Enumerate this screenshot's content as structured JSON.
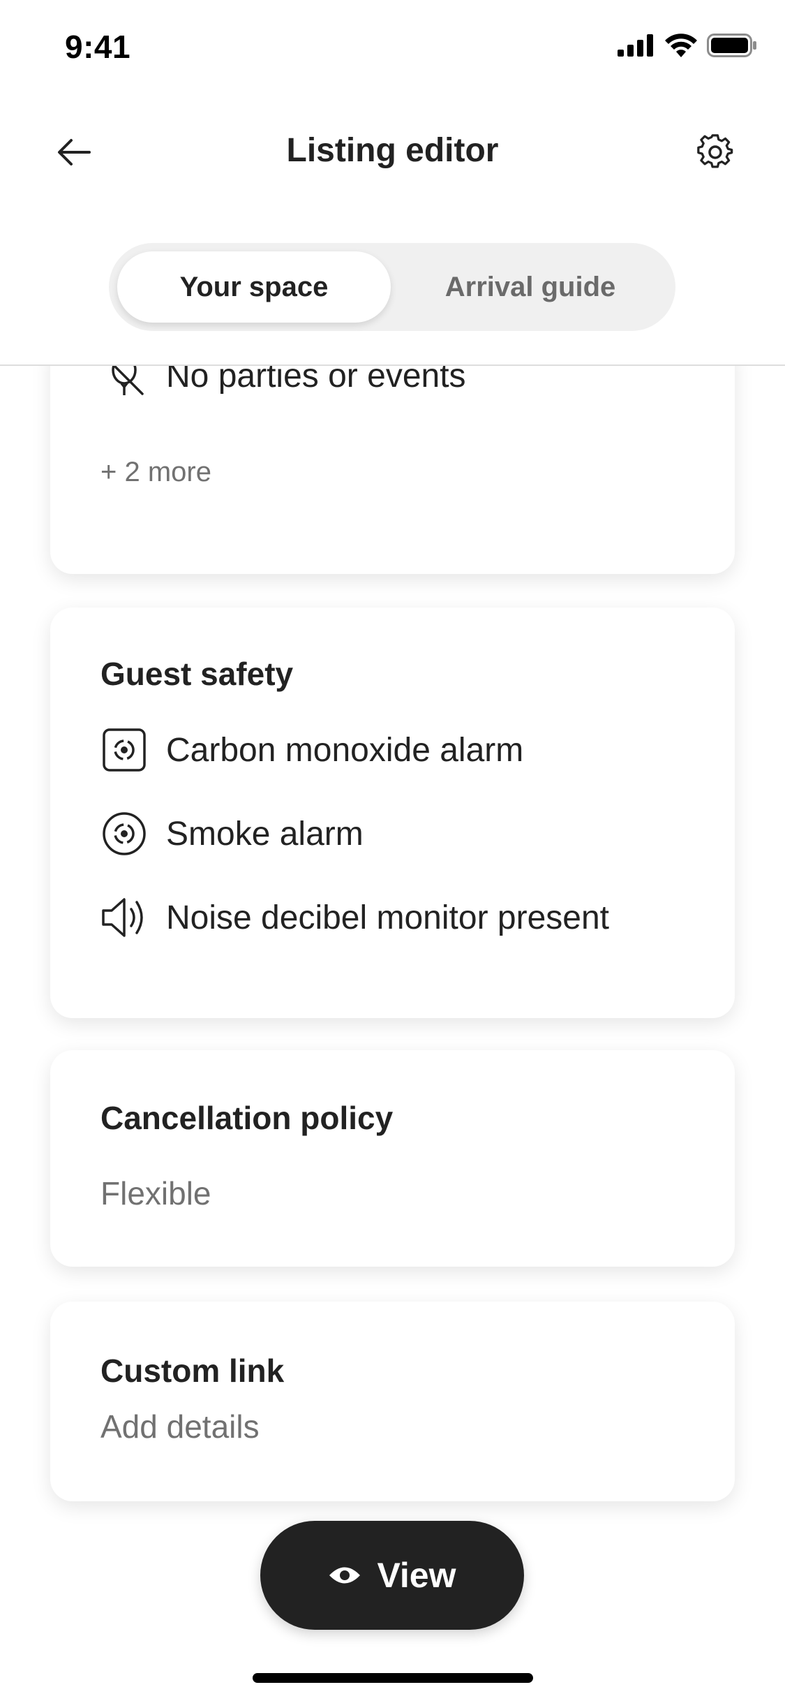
{
  "status_bar": {
    "time": "9:41"
  },
  "header": {
    "title": "Listing editor"
  },
  "tabs": [
    {
      "label": "Your space",
      "active": true
    },
    {
      "label": "Arrival guide",
      "active": false
    }
  ],
  "house_rules": {
    "items": [
      {
        "icon": "no-parties-icon",
        "label": "No parties or events"
      }
    ],
    "more_label": "+ 2 more"
  },
  "guest_safety": {
    "title": "Guest safety",
    "items": [
      {
        "icon": "carbon-monoxide-icon",
        "label": "Carbon monoxide alarm"
      },
      {
        "icon": "smoke-alarm-icon",
        "label": "Smoke alarm"
      },
      {
        "icon": "speaker-icon",
        "label": "Noise decibel monitor present"
      }
    ]
  },
  "cancellation_policy": {
    "title": "Cancellation policy",
    "value": "Flexible"
  },
  "custom_link": {
    "title": "Custom link",
    "value": "Add details"
  },
  "view_button": {
    "label": "View",
    "icon": "eye-icon"
  },
  "colors": {
    "text": "#222222",
    "muted": "#717171",
    "button_bg": "#222222",
    "segment_bg": "#f0f0f0"
  }
}
